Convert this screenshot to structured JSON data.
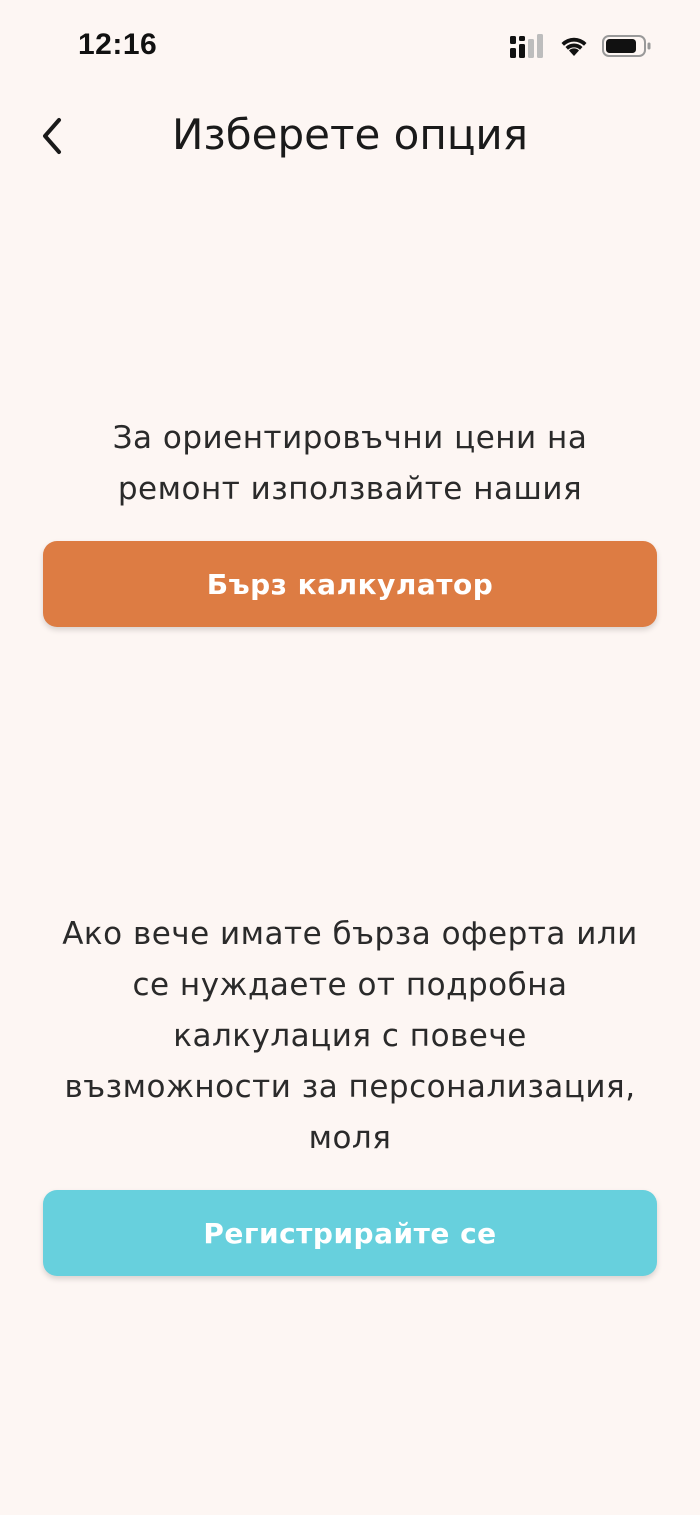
{
  "status_bar": {
    "time": "12:16",
    "icons": [
      "signal-icon",
      "wifi-icon",
      "battery-icon"
    ]
  },
  "header": {
    "title": "Изберете опция",
    "back_icon": "chevron-left-icon"
  },
  "calculator_section": {
    "text": "За ориентировъчни цени на ремонт използвайте нашия",
    "button_label": "Бърз калкулатор"
  },
  "register_section": {
    "text": "Ако вече имате бърза оферта или се нуждаете от подробна калкулация с повече възможности за персонализация, моля",
    "button_label": "Регистрирайте се"
  },
  "colors": {
    "background": "#fdf6f3",
    "primary_orange": "#dd7c43",
    "accent_cyan": "#67d0dd",
    "text": "#222222"
  }
}
